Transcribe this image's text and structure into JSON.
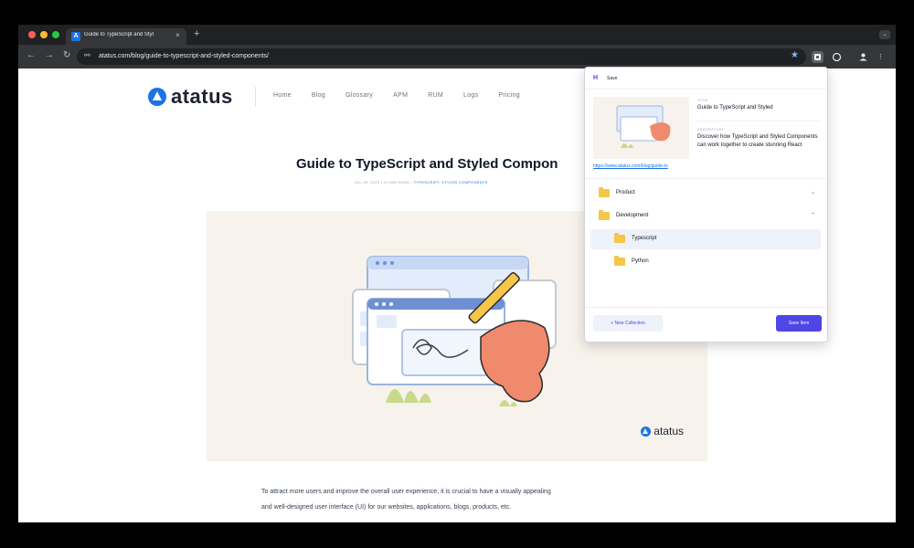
{
  "browser": {
    "tab_title": "Guide to TypeScript and Styl",
    "tab_favicon": "A",
    "tab_close": "×",
    "new_tab": "+",
    "tab_menu": "⌄",
    "url": "atatus.com/blog/guide-to-typescript-and-styled-components/",
    "back": "←",
    "forward": "→",
    "reload": "↻",
    "site_info": "⚯",
    "star": "★",
    "menu": "⋮",
    "colors": {
      "frame": "#202124",
      "toolbar": "#35363a",
      "accent": "#8ab4f8"
    }
  },
  "site": {
    "logo_text": "atatus",
    "nav": [
      "Home",
      "Blog",
      "Glossary",
      "APM",
      "RUM",
      "Logs",
      "Pricing"
    ],
    "brand_color": "#1a73e8"
  },
  "article": {
    "title": "Guide to TypeScript and Styled Compon",
    "date": "JUL 25, 2023",
    "read_time": "10 MIN READ",
    "tags": "TYPESCRIPT, STYLED COMPONENTS",
    "hero_logo_text": "atatus",
    "paragraph_lines": [
      "To attract more users and improve the overall user experience, it is crucial to have a visually appealing",
      "and well-designed user interface (UI) for our websites, applications, blogs, products, etc."
    ]
  },
  "popup": {
    "logo": "H",
    "title": "Save",
    "preview_url": "https://www.atatus.com/blog/guide-to",
    "title_label": "TITLE",
    "title_value": "Guide to TypeScript and Styled",
    "description_label": "DESCRIPTION",
    "description_value": "Discover how TypeScript and Styled Components can work together to create stunning React",
    "folders": [
      {
        "label": "Product",
        "chevron": "⌄"
      },
      {
        "label": "Development",
        "chevron": "⌃"
      },
      {
        "label": "Typescript",
        "selected": true
      },
      {
        "label": "Python"
      }
    ],
    "new_collection": "+ New Collection",
    "save_item": "Save Item",
    "accent": "#4f46e5"
  }
}
